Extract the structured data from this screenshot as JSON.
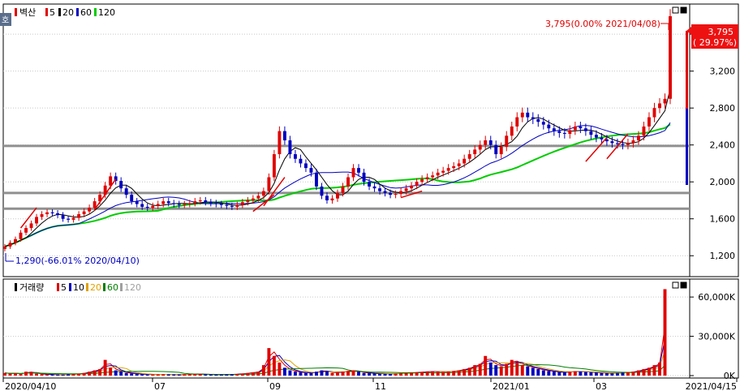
{
  "chart_data": [
    {
      "type": "candlestick",
      "title": "벽산",
      "ma_labels": [
        "5",
        "20",
        "60",
        "120"
      ],
      "ma_colors": [
        "#e00000",
        "#000000",
        "#0000c0",
        "#00cc00"
      ],
      "corner_tab": "호",
      "y_ticks": [
        1200,
        1600,
        2000,
        2400,
        2800,
        3200,
        3600
      ],
      "y_tick_labels": [
        "1,200",
        "1,600",
        "2,000",
        "2,400",
        "2,800",
        "3,200",
        "3,600"
      ],
      "ylim": [
        1000,
        3900
      ],
      "x_tick_labels": [
        "2020/04/10",
        "07",
        "09",
        "11",
        "2021/01",
        "03",
        "2021/04/15"
      ],
      "last_price_label": "3,795",
      "last_change_label": "( 29.97%)",
      "max_annotation": "3,795(0.00% 2021/04/08)",
      "min_annotation": "1,290(-66.01% 2020/04/10)",
      "horizontal_levels": [
        2390,
        1880,
        1710
      ],
      "closes": [
        1300,
        1340,
        1380,
        1450,
        1500,
        1550,
        1620,
        1650,
        1670,
        1660,
        1640,
        1600,
        1590,
        1610,
        1650,
        1680,
        1720,
        1790,
        1860,
        1960,
        2060,
        2010,
        1930,
        1860,
        1790,
        1760,
        1730,
        1720,
        1740,
        1760,
        1790,
        1770,
        1760,
        1750,
        1760,
        1770,
        1790,
        1800,
        1780,
        1770,
        1760,
        1750,
        1740,
        1730,
        1750,
        1780,
        1800,
        1820,
        1850,
        1900,
        2050,
        2300,
        2550,
        2450,
        2300,
        2250,
        2200,
        2150,
        2100,
        1950,
        1850,
        1800,
        1820,
        1880,
        1950,
        2050,
        2150,
        2100,
        2000,
        1950,
        1930,
        1900,
        1880,
        1860,
        1870,
        1900,
        1930,
        1960,
        2000,
        2030,
        2050,
        2070,
        2100,
        2120,
        2150,
        2170,
        2200,
        2250,
        2300,
        2350,
        2400,
        2450,
        2400,
        2300,
        2380,
        2500,
        2600,
        2700,
        2750,
        2700,
        2680,
        2650,
        2620,
        2580,
        2550,
        2530,
        2520,
        2560,
        2600,
        2580,
        2550,
        2510,
        2480,
        2460,
        2440,
        2420,
        2410,
        2400,
        2420,
        2450,
        2500,
        2600,
        2700,
        2800,
        2850,
        2900,
        3795
      ]
    },
    {
      "type": "bar",
      "title": "거래량",
      "ma_labels": [
        "5",
        "10",
        "20",
        "60",
        "120"
      ],
      "ma_colors": [
        "#e00000",
        "#0000c0",
        "#e0a000",
        "#008000",
        "#a0a0a0"
      ],
      "y_ticks": [
        0,
        30000,
        60000
      ],
      "y_tick_labels": [
        "0K",
        "30,000K",
        "60,000K"
      ],
      "ylim": [
        0,
        70000
      ],
      "volumes_k": [
        2000,
        1500,
        1800,
        1200,
        3000,
        2500,
        1500,
        1000,
        800,
        900,
        800,
        700,
        900,
        1000,
        1500,
        2000,
        3000,
        4000,
        5000,
        12000,
        6000,
        4000,
        3000,
        2000,
        1500,
        1200,
        1000,
        900,
        800,
        900,
        1000,
        900,
        800,
        800,
        900,
        1000,
        1200,
        1100,
        900,
        800,
        700,
        700,
        800,
        900,
        1200,
        1500,
        2000,
        2500,
        3000,
        8000,
        21000,
        15000,
        10000,
        6000,
        4000,
        3000,
        2500,
        2000,
        1800,
        3000,
        4000,
        3000,
        2000,
        2500,
        3000,
        3500,
        4000,
        3000,
        2000,
        1800,
        1600,
        1500,
        1400,
        1300,
        1500,
        1800,
        2000,
        2200,
        2500,
        2800,
        3000,
        3200,
        3000,
        2800,
        3000,
        3500,
        4000,
        5000,
        6000,
        8000,
        9000,
        15000,
        10000,
        8000,
        7000,
        9000,
        12000,
        10000,
        8000,
        7000,
        6000,
        5000,
        4000,
        3500,
        3000,
        2500,
        2500,
        3000,
        3200,
        3000,
        2800,
        2500,
        2300,
        2000,
        1800,
        1800,
        2000,
        2200,
        2500,
        3000,
        4000,
        5000,
        6000,
        8000,
        10000,
        66000
      ]
    }
  ]
}
